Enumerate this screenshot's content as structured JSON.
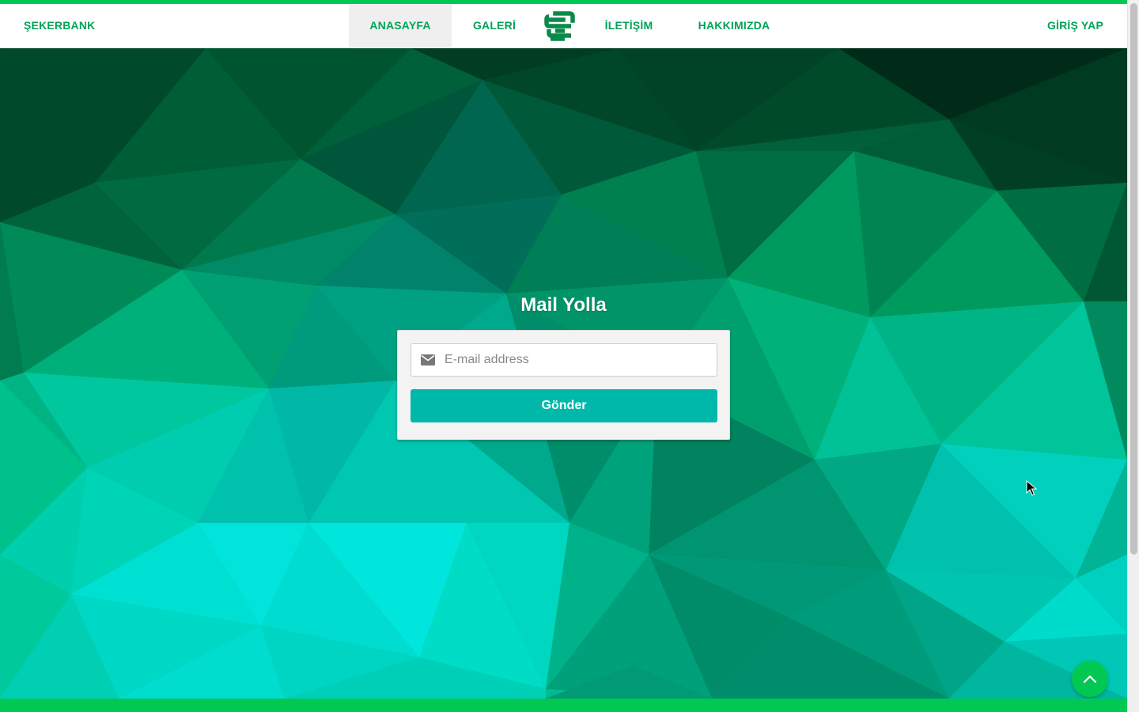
{
  "navbar": {
    "brand": "ŞEKERBANK",
    "items": [
      {
        "label": "ANASAYFA",
        "active": true
      },
      {
        "label": "GALERİ",
        "active": false
      },
      {
        "label": "İLETİŞİM",
        "active": false
      },
      {
        "label": "HAKKIMIZDA",
        "active": false
      }
    ],
    "login_label": "GİRİŞ YAP",
    "logo_icon": "sekerbank-logo-icon"
  },
  "form": {
    "title": "Mail Yolla",
    "email_placeholder": "E-mail address",
    "email_value": "",
    "email_icon": "envelope-icon",
    "submit_label": "Gönder"
  },
  "scroll_top_icon": "chevron-up-icon",
  "colors": {
    "accent_green": "#00c853",
    "link_green": "#00a35a",
    "button_teal": "#00b8a9"
  }
}
